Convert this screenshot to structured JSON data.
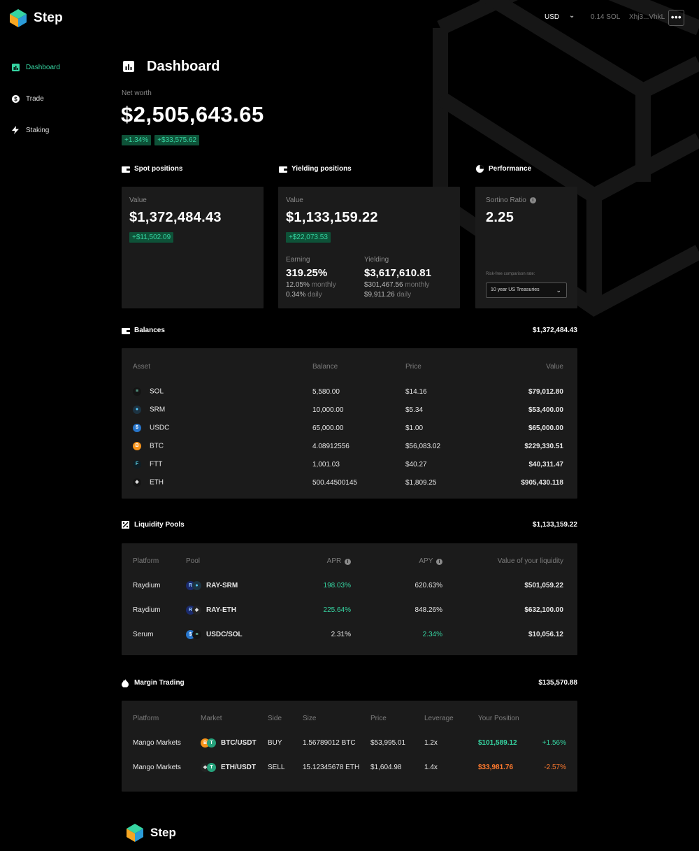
{
  "app": {
    "name": "Step"
  },
  "header": {
    "currency": "USD",
    "sol_balance": "0.14 SOL",
    "wallet": "Xhj3...VhkL",
    "more_label": "•••"
  },
  "sidebar": {
    "items": [
      {
        "label": "Dashboard",
        "icon": "chart-icon",
        "active": true
      },
      {
        "label": "Trade",
        "icon": "dollar-icon",
        "active": false
      },
      {
        "label": "Staking",
        "icon": "bolt-icon",
        "active": false
      }
    ]
  },
  "page": {
    "title": "Dashboard"
  },
  "net_worth": {
    "label": "Net worth",
    "value": "$2,505,643.65",
    "change_pct": "+1.34%",
    "change_abs": "+$33,575.62"
  },
  "spot": {
    "heading": "Spot positions",
    "value_label": "Value",
    "value": "$1,372,484.43",
    "change": "+$11,502.09"
  },
  "yielding": {
    "heading": "Yielding positions",
    "value_label": "Value",
    "value": "$1,133,159.22",
    "change": "+$22,073.53",
    "earning": {
      "label": "Earning",
      "value": "319.25%",
      "monthly": "12.05%",
      "monthly_word": "monthly",
      "daily": "0.34%",
      "daily_word": "daily"
    },
    "yield": {
      "label": "Yielding",
      "value": "$3,617,610.81",
      "monthly": "$301,467.56",
      "monthly_word": "monthly",
      "daily": "$9,911.26",
      "daily_word": "daily"
    }
  },
  "performance": {
    "heading": "Performance",
    "sortino_label": "Sortino Ratio",
    "sortino_value": "2.25",
    "rate_label": "Risk-free comparison rate:",
    "rate_selected": "10 year US Treasuries"
  },
  "balances": {
    "heading": "Balances",
    "total": "$1,372,484.43",
    "columns": [
      "Asset",
      "Balance",
      "Price",
      "Value"
    ],
    "rows": [
      {
        "asset": "SOL",
        "balance": "5,580.00",
        "price": "$14.16",
        "value": "$79,012.80",
        "icon": "sol-icon"
      },
      {
        "asset": "SRM",
        "balance": "10,000.00",
        "price": "$5.34",
        "value": "$53,400.00",
        "icon": "srm-icon"
      },
      {
        "asset": "USDC",
        "balance": "65,000.00",
        "price": "$1.00",
        "value": "$65,000.00",
        "icon": "usdc-icon"
      },
      {
        "asset": "BTC",
        "balance": "4.08912556",
        "price": "$56,083.02",
        "value": "$229,330.51",
        "icon": "btc-icon"
      },
      {
        "asset": "FTT",
        "balance": "1,001.03",
        "price": "$40.27",
        "value": "$40,311.47",
        "icon": "ftt-icon"
      },
      {
        "asset": "ETH",
        "balance": "500.44500145",
        "price": "$1,809.25",
        "value": "$905,430.118",
        "icon": "eth-icon"
      }
    ]
  },
  "pools": {
    "heading": "Liquidity Pools",
    "total": "$1,133,159.22",
    "columns": [
      "Platform",
      "Pool",
      "APR",
      "APY",
      "Value of your liquidity"
    ],
    "rows": [
      {
        "platform": "Raydium",
        "pool": "RAY-SRM",
        "apr": "198.03%",
        "apy": "620.63%",
        "value": "$501,059.22"
      },
      {
        "platform": "Raydium",
        "pool": "RAY-ETH",
        "apr": "225.64%",
        "apy": "848.26%",
        "value": "$632,100.00"
      },
      {
        "platform": "Serum",
        "pool": "USDC/SOL",
        "apr": "2.31%",
        "apy": "2.34%",
        "value": "$10,056.12"
      }
    ]
  },
  "margin": {
    "heading": "Margin Trading",
    "total": "$135,570.88",
    "columns": [
      "Platform",
      "Market",
      "Side",
      "Size",
      "Price",
      "Leverage",
      "Your Position"
    ],
    "rows": [
      {
        "platform": "Mango Markets",
        "market": "BTC/USDT",
        "side": "BUY",
        "size": "1.56789012 BTC",
        "price": "$53,995.01",
        "leverage": "1.2x",
        "position": "$101,589.12",
        "pnl": "+1.56%"
      },
      {
        "platform": "Mango Markets",
        "market": "ETH/USDT",
        "side": "SELL",
        "size": "15.12345678 ETH",
        "price": "$1,604.98",
        "leverage": "1.4x",
        "position": "$33,981.76",
        "pnl": "-2.57%"
      }
    ]
  },
  "footer": {
    "logo_text": "Step"
  },
  "colors": {
    "accent": "#36d5a2",
    "negative": "#ff7a2e",
    "card": "#1b1b1b",
    "background": "#000000"
  }
}
